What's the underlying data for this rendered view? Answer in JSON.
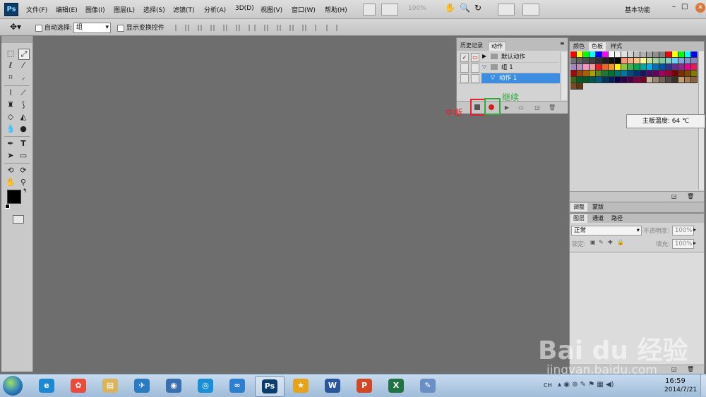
{
  "menubar": {
    "logo": "Ps",
    "items": [
      "文件(F)",
      "编辑(E)",
      "图像(I)",
      "图层(L)",
      "选择(S)",
      "滤镜(T)",
      "分析(A)",
      "3D(D)",
      "视图(V)",
      "窗口(W)",
      "帮助(H)"
    ],
    "zoom": "100%",
    "workspace": "基本功能",
    "win_controls": "–□"
  },
  "options": {
    "auto_select_label": "自动选择:",
    "auto_select_value": "组",
    "show_transform_label": "显示变换控件"
  },
  "actions_panel": {
    "tabs": [
      "历史记录",
      "动作"
    ],
    "rows": [
      {
        "label": "默认动作",
        "expander": "▶",
        "checked": true
      },
      {
        "label": "组 1",
        "expander": "▽",
        "checked": false
      },
      {
        "label": "动作 1",
        "expander": "▽",
        "checked": false
      }
    ]
  },
  "annotations": {
    "stop_label": "中断",
    "continue_label": "继续",
    "stop_color": "#e0202c",
    "continue_color": "#2faa3c"
  },
  "swatches_panel": {
    "tabs": [
      "颜色",
      "色板",
      "样式"
    ],
    "colors": [
      "#ff0000",
      "#ffff00",
      "#00ff00",
      "#00ffff",
      "#0000ff",
      "#ff00ff",
      "#ffffff",
      "#f0f0f0",
      "#e0e0e0",
      "#d0d0d0",
      "#c0c0c0",
      "#b0b0b0",
      "#a0a0a0",
      "#909090",
      "#808080",
      "#ff0000",
      "#ffff00",
      "#00ff00",
      "#00ffff",
      "#0000ff",
      "#707070",
      "#606060",
      "#505050",
      "#404040",
      "#303030",
      "#202020",
      "#101010",
      "#000000",
      "#f7977a",
      "#f9ad81",
      "#fdc68a",
      "#fff79a",
      "#c4df9b",
      "#a2d39c",
      "#82ca9d",
      "#7bcdc8",
      "#6ecff6",
      "#7ea7d8",
      "#8493ca",
      "#8882be",
      "#a187be",
      "#bc8dbf",
      "#f49ac2",
      "#f6989d",
      "#ed1c24",
      "#f26522",
      "#f7941d",
      "#fff200",
      "#8dc63f",
      "#39b54a",
      "#00a651",
      "#00a99d",
      "#00aeef",
      "#0072bc",
      "#0054a6",
      "#2e3192",
      "#662d91",
      "#92278f",
      "#ec008c",
      "#ed145b",
      "#9e0b0f",
      "#a0410d",
      "#a36209",
      "#aba000",
      "#598527",
      "#1a7b30",
      "#007236",
      "#00746b",
      "#0076a3",
      "#004b80",
      "#003471",
      "#1b1464",
      "#440e62",
      "#630460",
      "#9e005d",
      "#9e0039",
      "#790000",
      "#7b2e00",
      "#7d4900",
      "#827b00",
      "#406618",
      "#005e20",
      "#005826",
      "#005952",
      "#005b7f",
      "#003663",
      "#002157",
      "#0d004c",
      "#32004b",
      "#4b0049",
      "#7b0046",
      "#7a0026",
      "#c7b299",
      "#998675",
      "#736357",
      "#534741",
      "#37302d",
      "#c69c6d",
      "#a67c52",
      "#8c6239",
      "#754c24",
      "#603913"
    ],
    "tooltip": "主板温度: 64 ℃"
  },
  "adjust_panel": {
    "tabs": [
      "调整",
      "蒙版"
    ]
  },
  "layers_panel": {
    "tabs": [
      "图层",
      "通道",
      "路径"
    ],
    "blend_mode": "正常",
    "opacity_label": "不透明度:",
    "opacity_value": "100%",
    "lock_label": "锁定:",
    "fill_label": "填充:",
    "fill_value": "100%"
  },
  "taskbar": {
    "apps": [
      {
        "name": "ie",
        "glyph": "e",
        "color": "#1e88d0"
      },
      {
        "name": "picasa",
        "glyph": "✿",
        "color": "#e94b3c"
      },
      {
        "name": "explorer",
        "glyph": "▤",
        "color": "#d9b45a"
      },
      {
        "name": "bird",
        "glyph": "✈",
        "color": "#2a7bc0"
      },
      {
        "name": "globe",
        "glyph": "◉",
        "color": "#3a6fb0"
      },
      {
        "name": "browser",
        "glyph": "◎",
        "color": "#1b8fd6"
      },
      {
        "name": "cloud",
        "glyph": "∞",
        "color": "#2f7fd0"
      },
      {
        "name": "photoshop",
        "glyph": "Ps",
        "color": "#0b3c6a"
      },
      {
        "name": "gift",
        "glyph": "★",
        "color": "#e6a21b"
      },
      {
        "name": "word",
        "glyph": "W",
        "color": "#2b579a"
      },
      {
        "name": "powerpoint",
        "glyph": "P",
        "color": "#d24726"
      },
      {
        "name": "excel",
        "glyph": "X",
        "color": "#217346"
      },
      {
        "name": "paint",
        "glyph": "✎",
        "color": "#6a8fc4"
      }
    ],
    "tray_lang": "CH",
    "time": "16:59",
    "date": "2014/7/21"
  },
  "watermark": {
    "logo": "Bai du 经验",
    "url": "jingyan.baidu.com"
  }
}
